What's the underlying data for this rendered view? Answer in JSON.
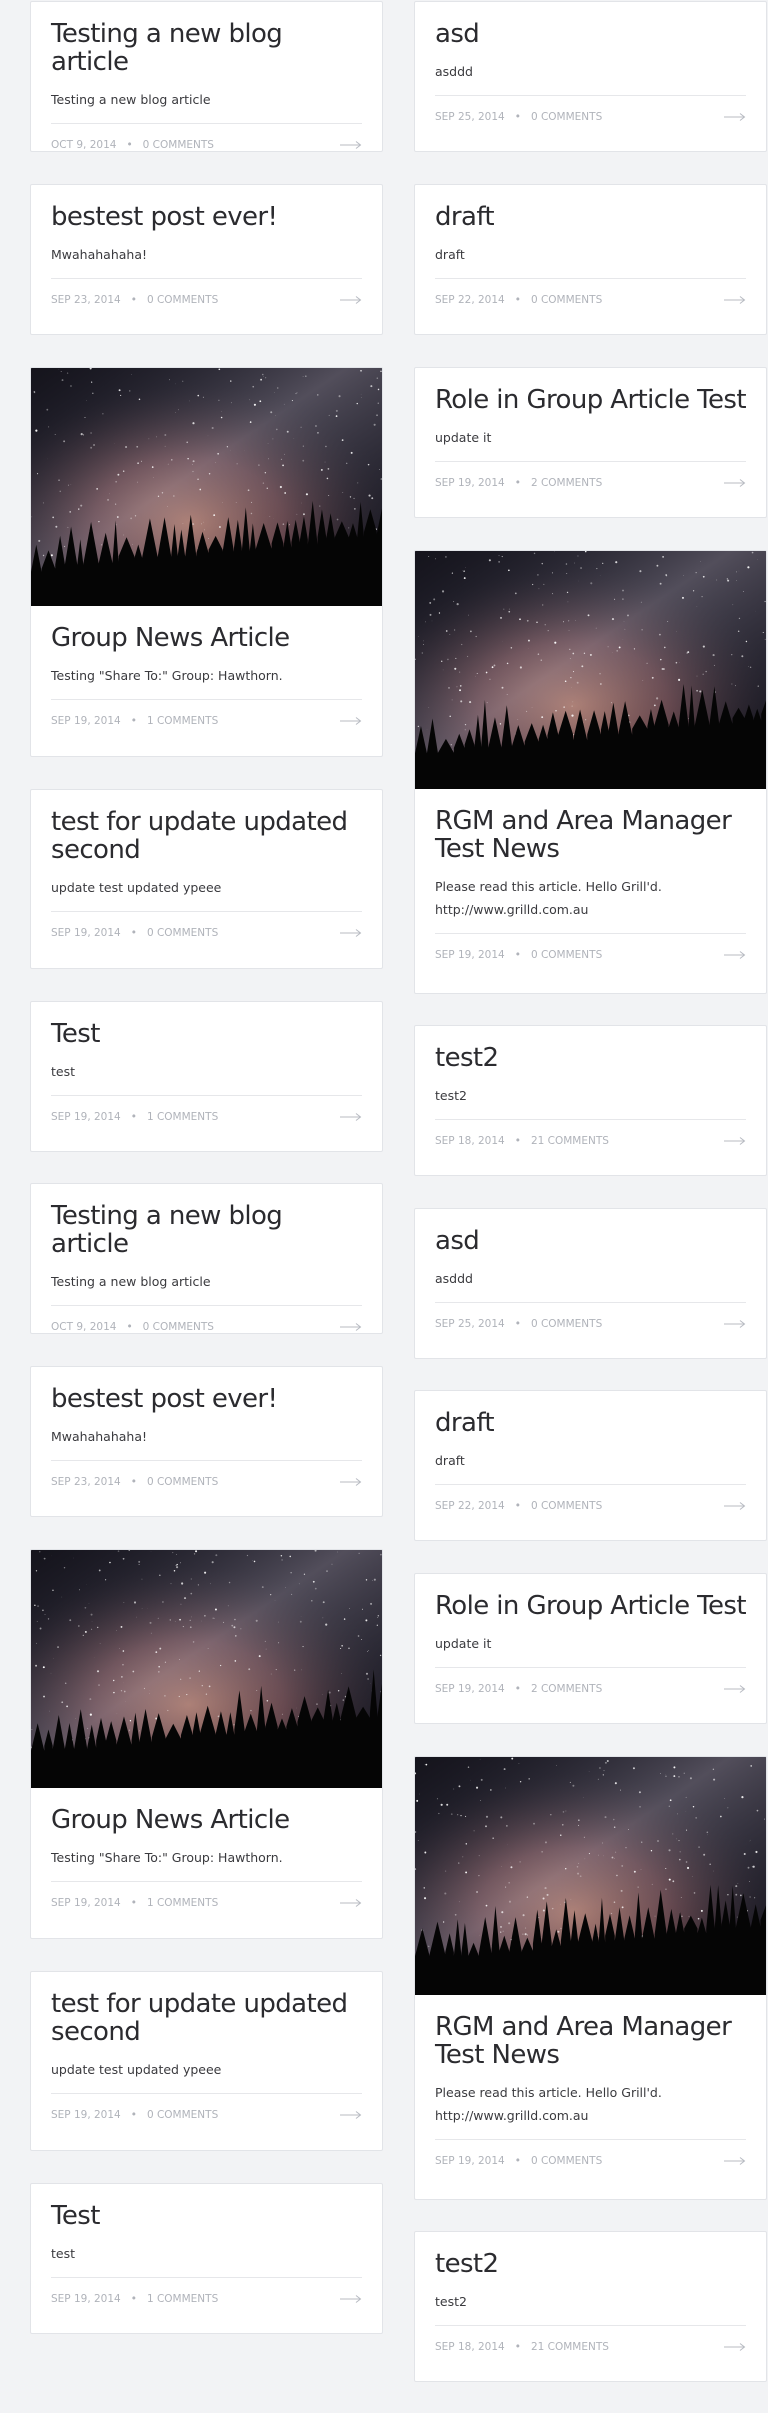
{
  "posts": [
    {
      "title": "Testing a new blog article",
      "excerpt": "Testing a new blog article",
      "date": "OCT 9, 2014",
      "comments": "0 COMMENTS"
    },
    {
      "title": "asd",
      "excerpt": "asddd",
      "date": "SEP 25, 2014",
      "comments": "0 COMMENTS"
    },
    {
      "title": "bestest post ever!",
      "excerpt": "Mwahahahaha!",
      "date": "SEP 23, 2014",
      "comments": "0 COMMENTS"
    },
    {
      "title": "draft",
      "excerpt": "draft",
      "date": "SEP 22, 2014",
      "comments": "0 COMMENTS"
    },
    {
      "title": "Role in Group Article Test",
      "excerpt": "update it",
      "date": "SEP 19, 2014",
      "comments": "2 COMMENTS"
    },
    {
      "title": "Group News Article",
      "excerpt": "Testing \"Share To:\" Group: Hawthorn.",
      "date": "SEP 19, 2014",
      "comments": "1 COMMENTS",
      "image": "starry-night-image"
    },
    {
      "title": "RGM and Area Manager Test News",
      "excerpt": "Please read this article. Hello Grill'd.",
      "excerpt2": "http://www.grilld.com.au",
      "date": "SEP 19, 2014",
      "comments": "0 COMMENTS",
      "image": "starry-night-image"
    },
    {
      "title": "test for update updated second",
      "excerpt": "update test updated ypeee",
      "date": "SEP 19, 2014",
      "comments": "0 COMMENTS"
    },
    {
      "title": "Test",
      "excerpt": "test",
      "date": "SEP 19, 2014",
      "comments": "1 COMMENTS"
    },
    {
      "title": "test2",
      "excerpt": "test2",
      "date": "SEP 18, 2014",
      "comments": "21 COMMENTS"
    },
    {
      "title": "Testing a new blog article",
      "excerpt": "Testing a new blog article",
      "date": "OCT 9, 2014",
      "comments": "0 COMMENTS"
    },
    {
      "title": "asd",
      "excerpt": "asddd",
      "date": "SEP 25, 2014",
      "comments": "0 COMMENTS"
    },
    {
      "title": "bestest post ever!",
      "excerpt": "Mwahahahaha!",
      "date": "SEP 23, 2014",
      "comments": "0 COMMENTS"
    },
    {
      "title": "draft",
      "excerpt": "draft",
      "date": "SEP 22, 2014",
      "comments": "0 COMMENTS"
    },
    {
      "title": "Role in Group Article Test",
      "excerpt": "update it",
      "date": "SEP 19, 2014",
      "comments": "2 COMMENTS"
    },
    {
      "title": "Group News Article",
      "excerpt": "Testing \"Share To:\" Group: Hawthorn.",
      "date": "SEP 19, 2014",
      "comments": "1 COMMENTS",
      "image": "starry-night-image"
    },
    {
      "title": "RGM and Area Manager Test News",
      "excerpt": "Please read this article. Hello Grill'd.",
      "excerpt2": "http://www.grilld.com.au",
      "date": "SEP 19, 2014",
      "comments": "0 COMMENTS",
      "image": "starry-night-image"
    },
    {
      "title": "test for update updated second",
      "excerpt": "update test updated ypeee",
      "date": "SEP 19, 2014",
      "comments": "0 COMMENTS"
    },
    {
      "title": "Test",
      "excerpt": "test",
      "date": "SEP 19, 2014",
      "comments": "1 COMMENTS"
    },
    {
      "title": "test2",
      "excerpt": "test2",
      "date": "SEP 18, 2014",
      "comments": "21 COMMENTS"
    }
  ],
  "separator": "•",
  "icons": {
    "read_more": "arrow-right-icon"
  },
  "colors": {
    "background": "#f2f3f5",
    "card": "#ffffff",
    "title": "#2b2b2f",
    "meta": "#b0b3ba"
  }
}
